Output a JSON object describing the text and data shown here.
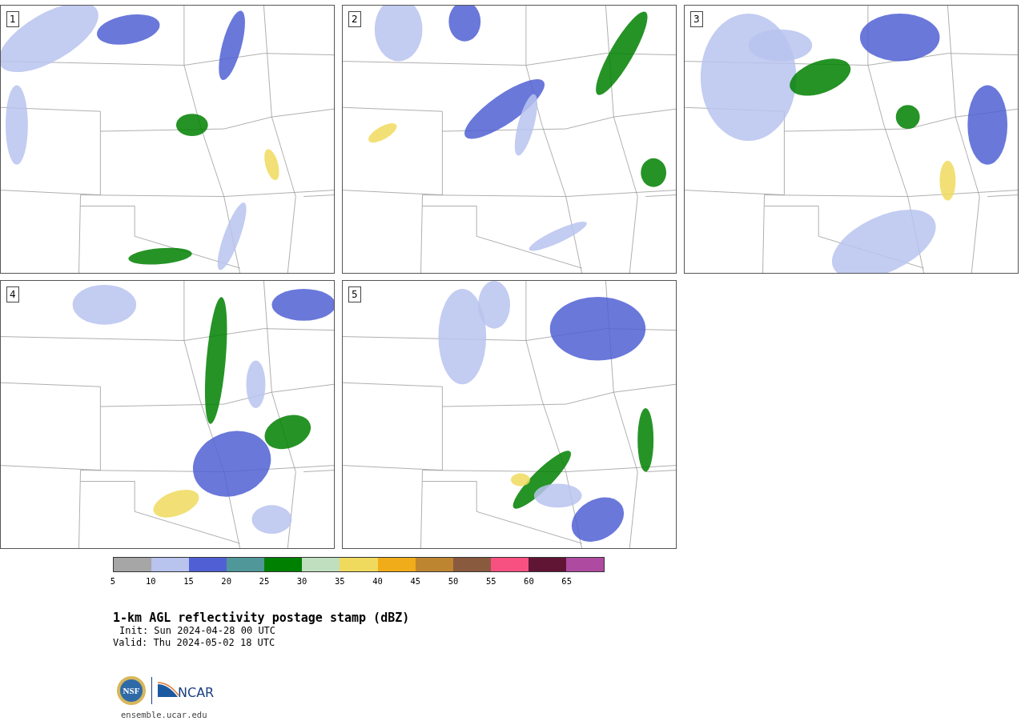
{
  "panels": [
    {
      "label": "1"
    },
    {
      "label": "2"
    },
    {
      "label": "3"
    },
    {
      "label": "4"
    },
    {
      "label": "5"
    }
  ],
  "colorbar": {
    "segments": [
      {
        "color": "#a6a6a6"
      },
      {
        "color": "#b8c3ee"
      },
      {
        "color": "#5060d4"
      },
      {
        "color": "#50979a"
      },
      {
        "color": "#008000"
      },
      {
        "color": "#c0dfbf"
      },
      {
        "color": "#f0da5e"
      },
      {
        "color": "#f0ac19"
      },
      {
        "color": "#be8530"
      },
      {
        "color": "#8a5a3f"
      },
      {
        "color": "#f75181"
      },
      {
        "color": "#611535"
      },
      {
        "color": "#ae4ba0"
      }
    ],
    "ticks": [
      "5",
      "10",
      "15",
      "20",
      "25",
      "30",
      "35",
      "40",
      "45",
      "50",
      "55",
      "60",
      "65"
    ]
  },
  "title": "1-km AGL reflectivity postage stamp (dBZ)",
  "init": "Init: Sun 2024-04-28 00 UTC",
  "valid": "Valid: Thu 2024-05-02 18 UTC",
  "logos": {
    "nsf": "NSF",
    "ncar": "NCAR"
  },
  "url": "ensemble.ucar.edu"
}
